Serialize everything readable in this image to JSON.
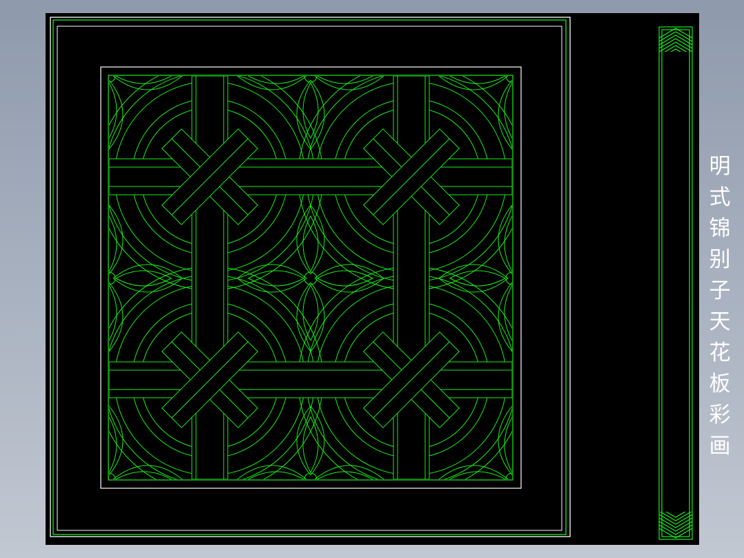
{
  "drawing": {
    "title_chars": [
      "明",
      "式",
      "锦",
      "别",
      "子",
      "天",
      "花",
      "板",
      "彩",
      "画"
    ]
  },
  "colors": {
    "background": "#000000",
    "pattern_line": "#19f019",
    "frame_line": "#ffffff",
    "title_text": "#ffffff"
  }
}
